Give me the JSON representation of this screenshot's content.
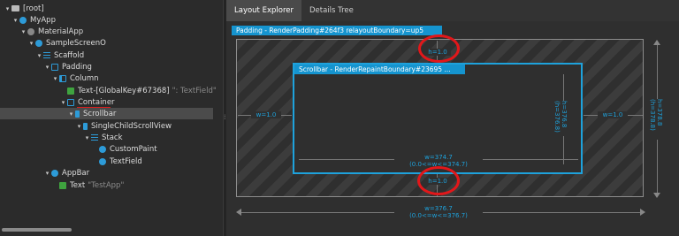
{
  "tree": {
    "rows": [
      {
        "label": "[root]",
        "hint": ""
      },
      {
        "label": "MyApp",
        "hint": ""
      },
      {
        "label": "MaterialApp",
        "hint": ""
      },
      {
        "label": "SampleScreenO",
        "hint": ""
      },
      {
        "label": "Scaffold",
        "hint": ""
      },
      {
        "label": "Padding",
        "hint": ""
      },
      {
        "label": "Column",
        "hint": ""
      },
      {
        "label": "Text-[GlobalKey#67368]",
        "hint": "\": TextField\""
      },
      {
        "label": "Container",
        "hint": ""
      },
      {
        "label": "Scrollbar",
        "hint": ""
      },
      {
        "label": "SingleChildScrollView",
        "hint": ""
      },
      {
        "label": "Stack",
        "hint": ""
      },
      {
        "label": "CustomPaint",
        "hint": ""
      },
      {
        "label": "TextField",
        "hint": ""
      },
      {
        "label": "AppBar",
        "hint": ""
      },
      {
        "label": "Text",
        "hint": "\"TestApp\""
      }
    ],
    "selected": "Scrollbar",
    "highlight_color": "#d91e1e"
  },
  "tabs": [
    "Layout Explorer",
    "Details Tree"
  ],
  "active_tab": "Layout Explorer",
  "explorer": {
    "outer_label": "Padding - RenderPadding#264f3 relayoutBoundary=up5",
    "inner_label": "Scrollbar - RenderRepaintBoundary#23695 ...",
    "top_padding": "h=1.0",
    "bottom_padding": "h=1.0",
    "left_padding": "w=1.0",
    "right_padding": "w=1.0",
    "inner_height": "h=376.8\n(h=376.8)",
    "inner_width": "w=374.7\n(0.0<=w<=374.7)",
    "outer_height": "h=378.8\n(h=378.8)",
    "outer_width": "w=376.7\n(0.0<=w<=376.7)",
    "accent_color": "#1ea2dc",
    "annotation_color": "#e2171a"
  }
}
